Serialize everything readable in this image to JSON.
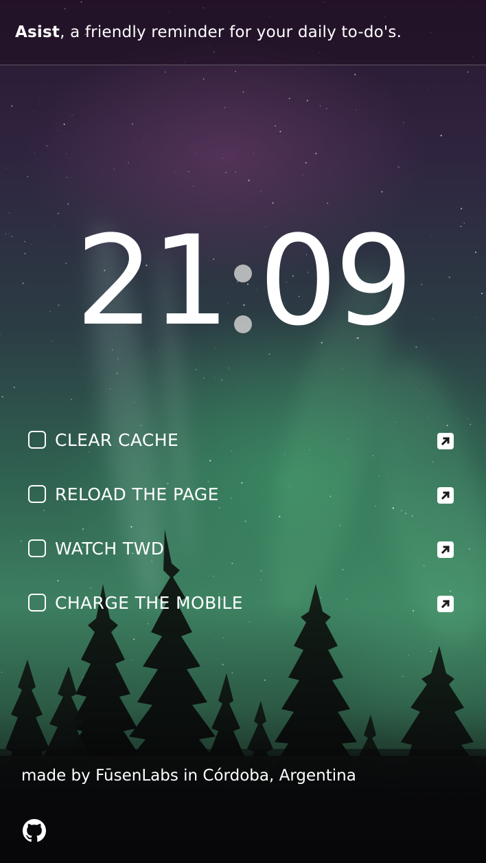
{
  "header": {
    "app_name": "Asist",
    "tagline_rest": ", a friendly reminder for your daily to-do's."
  },
  "clock": {
    "hours": "21",
    "minutes": "09"
  },
  "todos": [
    {
      "label": "CLEAR CACHE",
      "checked": false,
      "icon": "external-link-icon"
    },
    {
      "label": "RELOAD THE PAGE",
      "checked": false,
      "icon": "external-link-icon"
    },
    {
      "label": "WATCH TWD",
      "checked": false,
      "icon": "external-link-icon"
    },
    {
      "label": "CHARGE THE MOBILE",
      "checked": false,
      "icon": "external-link-icon"
    }
  ],
  "footer": {
    "credit": "made by FūsenLabs in Córdoba, Argentina",
    "github_icon": "github-icon"
  },
  "colors": {
    "text": "#ffffff",
    "background_top": "#2a1830",
    "aurora_green": "#3d7f60"
  }
}
